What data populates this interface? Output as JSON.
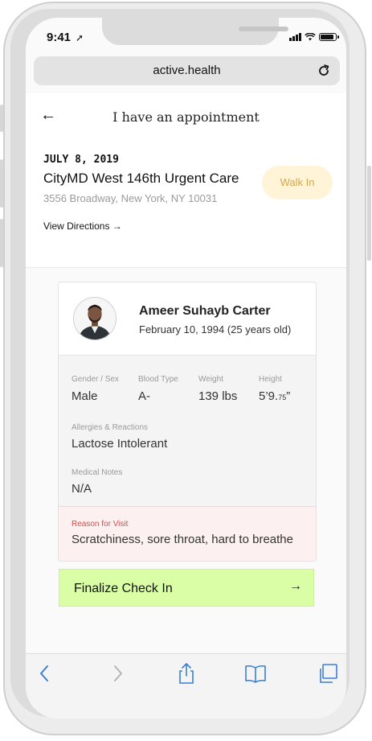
{
  "status_bar": {
    "time": "9:41",
    "location_glyph": "➚"
  },
  "browser": {
    "url": "active.health",
    "reload_icon": "reload-icon"
  },
  "header": {
    "back_label": "←",
    "title": "I have an appointment"
  },
  "appointment": {
    "date": "JULY 8, 2019",
    "clinic": "CityMD West 146th Urgent Care",
    "address": "3556 Broadway, New York, NY 10031",
    "directions_label": "View Directions →",
    "visit_type": "Walk In"
  },
  "patient": {
    "name": "Ameer Suhayb Carter",
    "dob": "February 10, 1994 (25 years old)",
    "gender_label": "Gender / Sex",
    "gender": "Male",
    "blood_label": "Blood Type",
    "blood": "A-",
    "weight_label": "Weight",
    "weight": "139 lbs",
    "height_label": "Height",
    "height_main": "5’9.",
    "height_frac": "75",
    "height_quote": "”",
    "allergies_label": "Allergies & Reactions",
    "allergies": "Lactose Intolerant",
    "notes_label": "Medical Notes",
    "notes": "N/A",
    "reason_label": "Reason for Visit",
    "reason": "Scratchiness, sore throat, hard to breathe"
  },
  "action": {
    "finalize_label": "Finalize Check In",
    "finalize_arrow": "→"
  },
  "colors": {
    "accent_green": "#dafea6",
    "walkin_bg": "#fff4d8",
    "walkin_text": "#d5a748",
    "reason_red": "#d44c4c",
    "ios_blue": "#3a7fd5"
  }
}
